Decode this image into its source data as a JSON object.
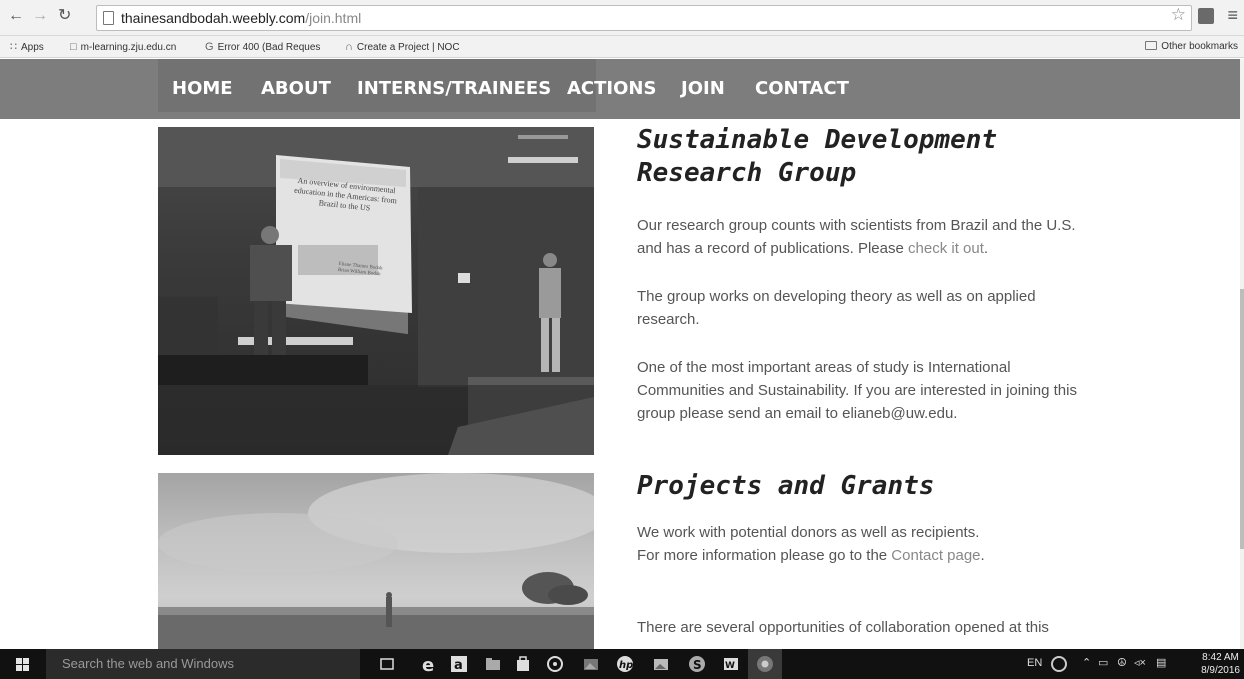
{
  "browser": {
    "url_host": "thainesandbodah.weebly.com",
    "url_path": "/join.html",
    "bookmarks": [
      {
        "label": "Apps"
      },
      {
        "label": "m-learning.zju.edu.cn"
      },
      {
        "label": "Error 400 (Bad Reques"
      },
      {
        "label": "Create a Project | NOC"
      }
    ],
    "other_bookmarks": "Other bookmarks"
  },
  "nav": {
    "items": [
      "HOME",
      "ABOUT",
      "INTERNS/TRAINEES",
      "ACTIONS",
      "JOIN",
      "CONTACT"
    ]
  },
  "slides": [
    {
      "title": "An overview of environmental education in the Americas: from Brazil to the US",
      "authors": "Eliane Thaines Bodah\nBrian William Bodah"
    }
  ],
  "sections": [
    {
      "heading_line1": "Sustainable Development",
      "heading_line2": "Research Group",
      "p1_before": "Our research group counts with scientists from Brazil and the U.S. and has a record of publications. Please ",
      "p1_link": "check it out",
      "p1_after": ".",
      "p2": "The group works on developing theory as well as on applied research.",
      "p3": "One of the most important areas of study is International Communities and Sustainability. If you are interested in joining this group please send an email to elianeb@uw.edu."
    },
    {
      "heading": "Projects and Grants",
      "p1_line1": "We work with potential donors as well as recipients.",
      "p1_line2_before": "For more information please go to the ",
      "p1_link": "Contact page",
      "p1_after": ".",
      "p2": "There are several opportunities of collaboration opened at this"
    }
  ],
  "taskbar": {
    "search_placeholder": "Search the web and Windows",
    "language": "EN",
    "time": "8:42 AM",
    "date": "8/9/2016"
  }
}
